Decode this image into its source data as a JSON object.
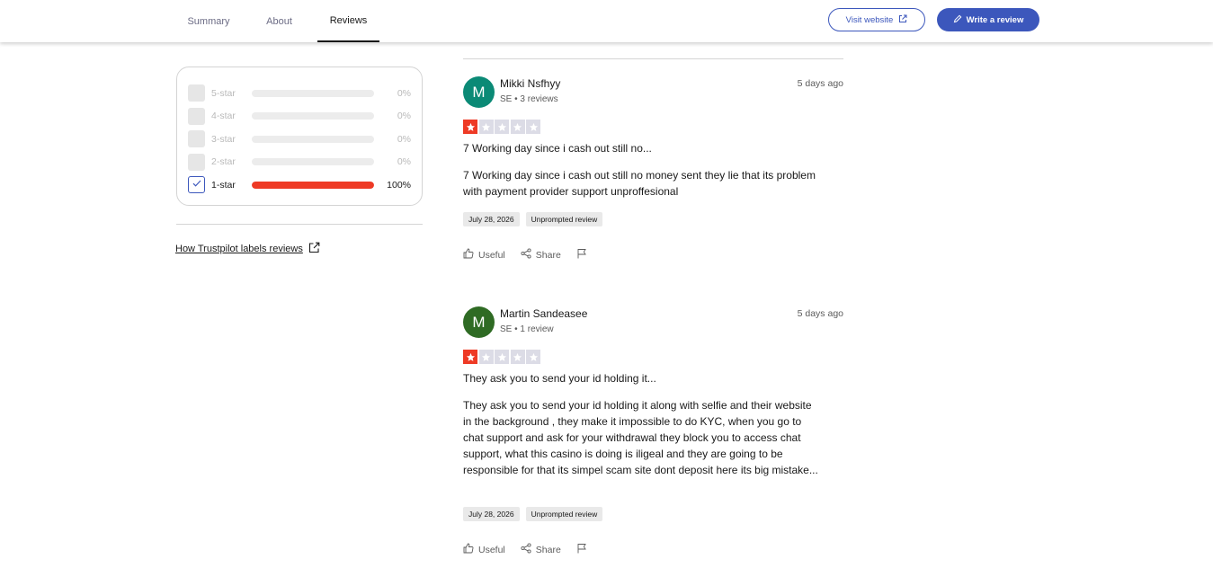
{
  "nav": {
    "tabs": [
      {
        "label": "Summary"
      },
      {
        "label": "About"
      },
      {
        "label": "Reviews"
      }
    ],
    "visit_label": "Visit website",
    "write_label": "Write a review"
  },
  "colors": {
    "accent": "#3c57bc",
    "star_red": "#ee3a25",
    "star_empty": "#dcdce6"
  },
  "filter": {
    "rows": [
      {
        "label": "5-star",
        "pct": "0%",
        "fraction": 0,
        "checked": false
      },
      {
        "label": "4-star",
        "pct": "0%",
        "fraction": 0,
        "checked": false
      },
      {
        "label": "3-star",
        "pct": "0%",
        "fraction": 0,
        "checked": false
      },
      {
        "label": "2-star",
        "pct": "0%",
        "fraction": 0,
        "checked": false
      },
      {
        "label": "1-star",
        "pct": "100%",
        "fraction": 1,
        "checked": true
      }
    ]
  },
  "labels_link": "How Trustpilot labels reviews",
  "reviews": [
    {
      "initial": "M",
      "avatar_color": "#0b8a76",
      "name": "Mikki Nsfhyy",
      "meta": "SE • 3 reviews",
      "time_ago": "5 days ago",
      "rating": 1,
      "title": "7 Working day since i cash out still no...",
      "body": "7 Working day since i cash out still no money sent they lie that its problem with payment provider support unproffesional",
      "date": "July 28, 2026",
      "tag": "Unprompted review",
      "useful": "Useful",
      "share": "Share"
    },
    {
      "initial": "M",
      "avatar_color": "#2f6b24",
      "name": "Martin Sandeasee",
      "meta": "SE • 1 review",
      "time_ago": "5 days ago",
      "rating": 1,
      "title": "They ask you to send your id holding it...",
      "body": "They ask you to send your id holding it along with selfie and their website in the background , they make it impossible to do KYC, when you go to chat support and ask for your withdrawal they block you to access chat support, what this casino is doing is iligeal and they are going to be responsible for that its simpel scam site dont deposit here its big mistake...",
      "date": "July 28, 2026",
      "tag": "Unprompted review",
      "useful": "Useful",
      "share": "Share"
    }
  ]
}
